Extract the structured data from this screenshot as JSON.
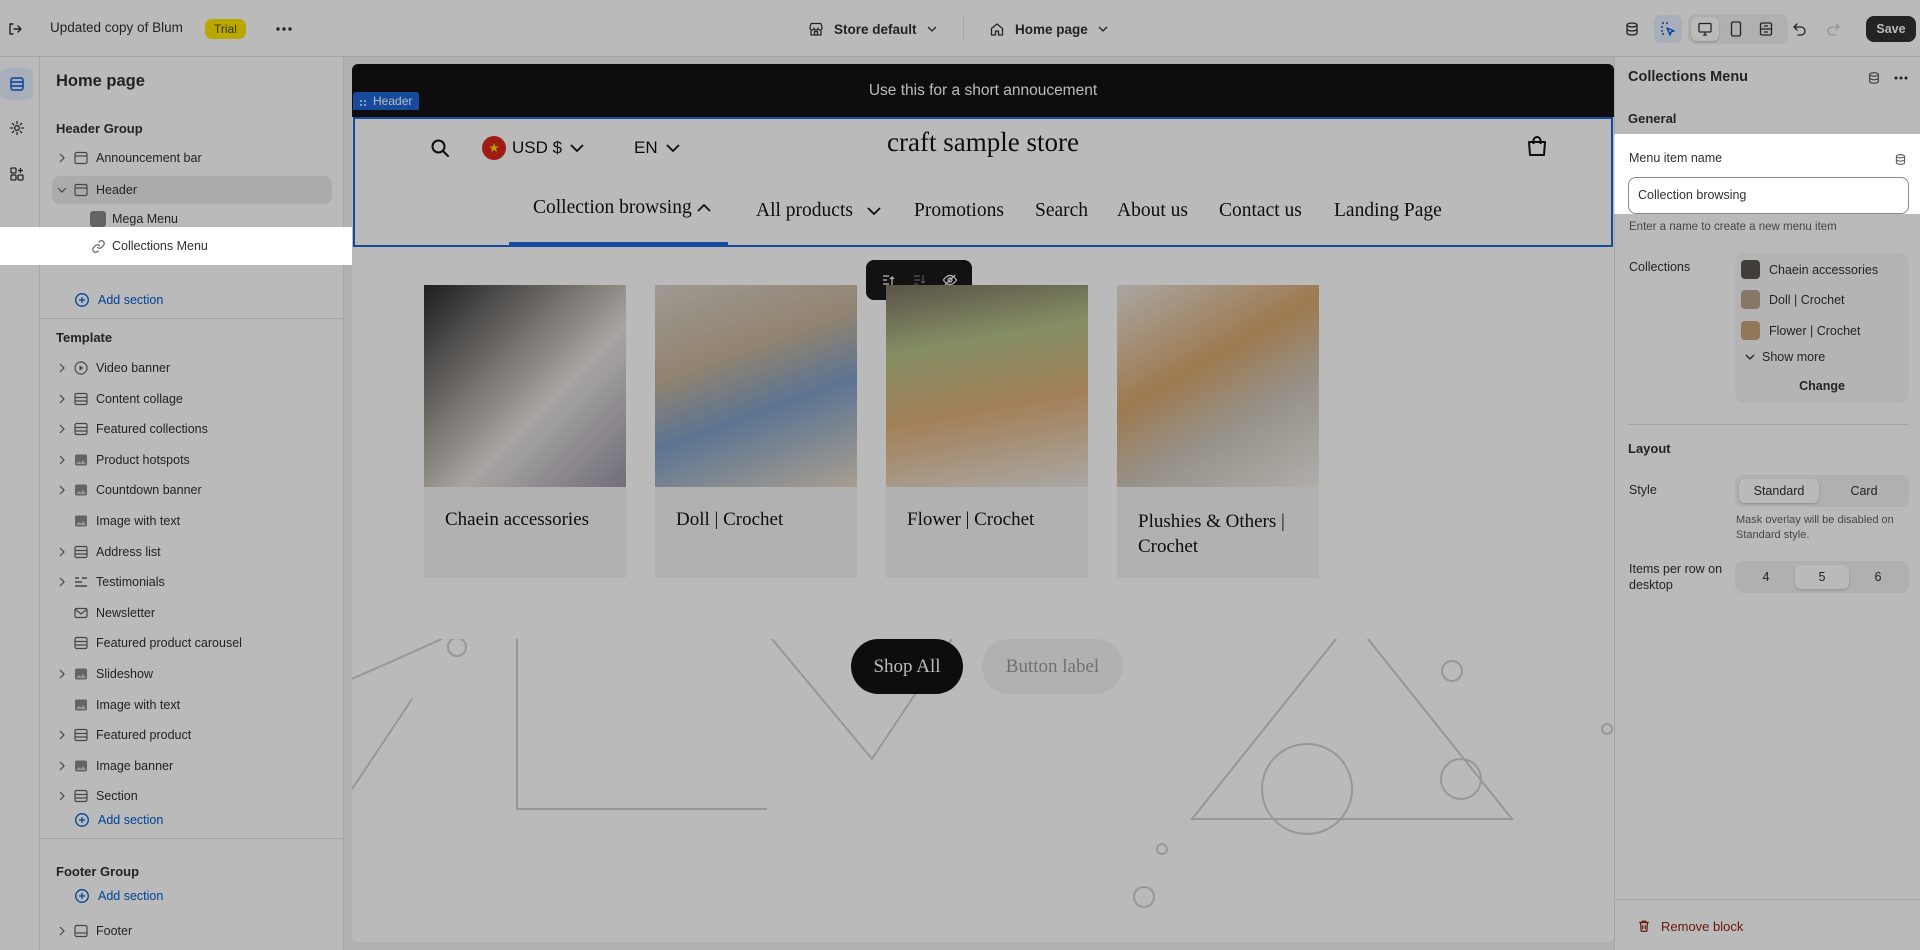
{
  "topbar": {
    "store_name": "Updated copy of Blum",
    "badge": "Trial",
    "theme_selector": "Store default",
    "page_selector": "Home page",
    "save_label": "Save"
  },
  "sidebar": {
    "title": "Home page",
    "header_group": {
      "title": "Header Group",
      "items": [
        {
          "label": "Announcement bar"
        },
        {
          "label": "Header"
        },
        {
          "label": "Mega Menu"
        },
        {
          "label": "Collections Menu"
        }
      ],
      "add_section": "Add section"
    },
    "template": {
      "title": "Template",
      "items": [
        {
          "label": "Video banner"
        },
        {
          "label": "Content collage"
        },
        {
          "label": "Featured collections"
        },
        {
          "label": "Product hotspots"
        },
        {
          "label": "Countdown banner"
        },
        {
          "label": "Image with text"
        },
        {
          "label": "Address list"
        },
        {
          "label": "Testimonials"
        },
        {
          "label": "Newsletter"
        },
        {
          "label": "Featured product carousel"
        },
        {
          "label": "Slideshow"
        },
        {
          "label": "Image with text"
        },
        {
          "label": "Featured product"
        },
        {
          "label": "Image banner"
        },
        {
          "label": "Section"
        }
      ],
      "add_section": "Add section"
    },
    "footer_group": {
      "title": "Footer Group",
      "add_section": "Add section",
      "items": [
        {
          "label": "Footer"
        }
      ]
    }
  },
  "preview": {
    "announcement": "Use this for a short annoucement",
    "header_tag": "Header",
    "currency": "USD $",
    "language": "EN",
    "store_title": "craft sample store",
    "nav": [
      {
        "label": "Collection browsing"
      },
      {
        "label": "All products"
      },
      {
        "label": "Promotions"
      },
      {
        "label": "Search"
      },
      {
        "label": "About us"
      },
      {
        "label": "Contact us"
      },
      {
        "label": "Landing Page"
      }
    ],
    "collections": [
      {
        "title": "Chaein accessories"
      },
      {
        "title": "Doll | Crochet"
      },
      {
        "title": "Flower | Crochet"
      },
      {
        "title": "Plushies & Others | Crochet"
      }
    ],
    "buttons": {
      "primary": "Shop All",
      "secondary": "Button label"
    }
  },
  "panel": {
    "title": "Collections Menu",
    "general": "General",
    "menu_item_name_label": "Menu item name",
    "menu_item_name_value": "Collection browsing",
    "menu_item_help": "Enter a name to create a new menu item",
    "collections_label": "Collections",
    "collections": [
      {
        "label": "Chaein accessories"
      },
      {
        "label": "Doll | Crochet"
      },
      {
        "label": "Flower | Crochet"
      }
    ],
    "show_more": "Show more",
    "change": "Change",
    "layout": "Layout",
    "style_label": "Style",
    "style_options": [
      "Standard",
      "Card"
    ],
    "style_selected": "Standard",
    "style_help": "Mask overlay will be disabled on Standard style.",
    "items_per_row_label": "Items per row on desktop",
    "items_per_row_options": [
      "4",
      "5",
      "6"
    ],
    "items_per_row_selected": "5",
    "remove_block": "Remove block"
  },
  "colors": {
    "accent": "#005bd3",
    "badge_bg": "#ffe600",
    "danger": "#8e1f0b"
  }
}
